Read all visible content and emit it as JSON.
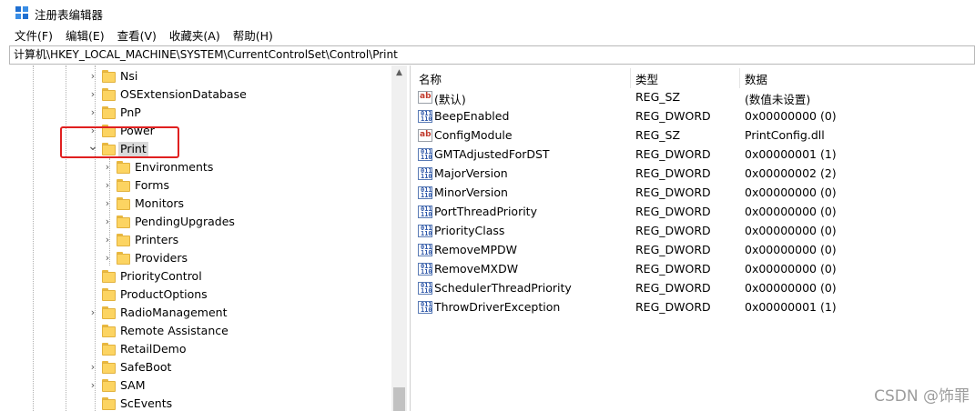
{
  "window": {
    "title": "注册表编辑器",
    "icon": "regedit-icon"
  },
  "menu": [
    "文件(F)",
    "编辑(E)",
    "查看(V)",
    "收藏夹(A)",
    "帮助(H)"
  ],
  "address": "计算机\\HKEY_LOCAL_MACHINE\\SYSTEM\\CurrentControlSet\\Control\\Print",
  "tree": [
    {
      "label": "Nsi",
      "level": 0,
      "expander": "collapsed"
    },
    {
      "label": "OSExtensionDatabase",
      "level": 0,
      "expander": "collapsed"
    },
    {
      "label": "PnP",
      "level": 0,
      "expander": "collapsed"
    },
    {
      "label": "Power",
      "level": 0,
      "expander": "collapsed"
    },
    {
      "label": "Print",
      "level": 0,
      "expander": "expanded",
      "selected": true
    },
    {
      "label": "Environments",
      "level": 1,
      "expander": "collapsed"
    },
    {
      "label": "Forms",
      "level": 1,
      "expander": "collapsed"
    },
    {
      "label": "Monitors",
      "level": 1,
      "expander": "collapsed"
    },
    {
      "label": "PendingUpgrades",
      "level": 1,
      "expander": "collapsed"
    },
    {
      "label": "Printers",
      "level": 1,
      "expander": "collapsed"
    },
    {
      "label": "Providers",
      "level": 1,
      "expander": "collapsed"
    },
    {
      "label": "PriorityControl",
      "level": 0,
      "expander": "none"
    },
    {
      "label": "ProductOptions",
      "level": 0,
      "expander": "none"
    },
    {
      "label": "RadioManagement",
      "level": 0,
      "expander": "collapsed"
    },
    {
      "label": "Remote Assistance",
      "level": 0,
      "expander": "none"
    },
    {
      "label": "RetailDemo",
      "level": 0,
      "expander": "none"
    },
    {
      "label": "SafeBoot",
      "level": 0,
      "expander": "collapsed"
    },
    {
      "label": "SAM",
      "level": 0,
      "expander": "collapsed"
    },
    {
      "label": "ScEvents",
      "level": 0,
      "expander": "none"
    }
  ],
  "columns": {
    "name": "名称",
    "type": "类型",
    "data": "数据"
  },
  "values": [
    {
      "name": "(默认)",
      "type": "REG_SZ",
      "data": "(数值未设置)",
      "icon": "string-value-icon"
    },
    {
      "name": "BeepEnabled",
      "type": "REG_DWORD",
      "data": "0x00000000 (0)",
      "icon": "binary-value-icon"
    },
    {
      "name": "ConfigModule",
      "type": "REG_SZ",
      "data": "PrintConfig.dll",
      "icon": "string-value-icon"
    },
    {
      "name": "GMTAdjustedForDST",
      "type": "REG_DWORD",
      "data": "0x00000001 (1)",
      "icon": "binary-value-icon"
    },
    {
      "name": "MajorVersion",
      "type": "REG_DWORD",
      "data": "0x00000002 (2)",
      "icon": "binary-value-icon"
    },
    {
      "name": "MinorVersion",
      "type": "REG_DWORD",
      "data": "0x00000000 (0)",
      "icon": "binary-value-icon"
    },
    {
      "name": "PortThreadPriority",
      "type": "REG_DWORD",
      "data": "0x00000000 (0)",
      "icon": "binary-value-icon"
    },
    {
      "name": "PriorityClass",
      "type": "REG_DWORD",
      "data": "0x00000000 (0)",
      "icon": "binary-value-icon"
    },
    {
      "name": "RemoveMPDW",
      "type": "REG_DWORD",
      "data": "0x00000000 (0)",
      "icon": "binary-value-icon"
    },
    {
      "name": "RemoveMXDW",
      "type": "REG_DWORD",
      "data": "0x00000000 (0)",
      "icon": "binary-value-icon"
    },
    {
      "name": "SchedulerThreadPriority",
      "type": "REG_DWORD",
      "data": "0x00000000 (0)",
      "icon": "binary-value-icon"
    },
    {
      "name": "ThrowDriverException",
      "type": "REG_DWORD",
      "data": "0x00000001 (1)",
      "icon": "binary-value-icon"
    }
  ],
  "icon_glyphs": {
    "string": "ab",
    "binary": "011\n110"
  },
  "watermark": "CSDN @饰罪",
  "colors": {
    "highlight_box": "#e02020",
    "folder": "#fcd462",
    "selection": "#d9d9d9"
  }
}
